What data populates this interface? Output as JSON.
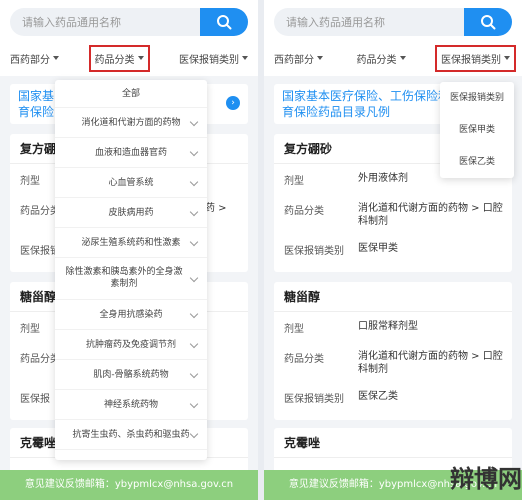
{
  "search": {
    "placeholder": "请输入药品通用名称"
  },
  "filters": {
    "western": "西药部分",
    "category": "药品分类",
    "reimburse": "医保报销类别"
  },
  "notice": {
    "text_line1": "国家基本医疗保险、工伤保险和",
    "text_line2": "育保险药品目录凡例",
    "left_line1": "国家基",
    "left_line2": "育保险"
  },
  "labels": {
    "form": "剂型",
    "category": "药品分类",
    "reimburse": "医保报销类别",
    "reimburse_short": "医保报"
  },
  "drugs": [
    {
      "name": "复方硼砂",
      "form": "外用液体剂",
      "category": "消化道和代谢方面的药物 > 口腔科制剂",
      "reimburse": "医保甲类",
      "left_name": "复方硼",
      "left_cat_tail": "用药 >"
    },
    {
      "name": "糖甾醇",
      "form": "口服常释剂型",
      "category": "消化道和代谢方面的药物 > 口腔科制剂",
      "reimburse": "医保乙类",
      "left_name": "糖甾醇"
    },
    {
      "name": "克霉唑",
      "left_name": "克霉唑"
    }
  ],
  "category_menu": [
    "全部",
    "消化道和代谢方面的药物",
    "血液和造血器官药",
    "心血管系统",
    "皮肤病用药",
    "泌尿生殖系统药和性激素",
    "除性激素和胰岛素外的全身激素制剂",
    "全身用抗感染药",
    "抗肿瘤药及免疫调节剂",
    "肌肉-骨骼系统药物",
    "神经系统药物",
    "抗寄生虫药、杀虫药和驱虫药"
  ],
  "reimburse_menu": [
    "医保报销类别",
    "医保甲类",
    "医保乙类"
  ],
  "footer": {
    "text": "意见建议反馈邮箱：ybypmlcx@nhsa.gov.cn"
  },
  "watermark": "辩博网",
  "colors": {
    "accent": "#1f8ff1",
    "highlight_border": "#d42a2a",
    "footer_bg": "#8dcf7e"
  }
}
